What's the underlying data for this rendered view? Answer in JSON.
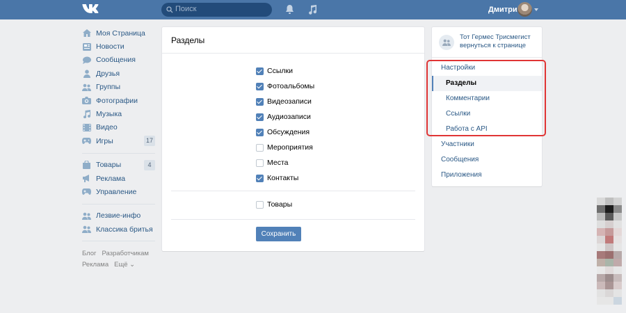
{
  "header": {
    "search_placeholder": "Поиск",
    "user_name": "Дмитрий",
    "colors": {
      "bar": "#4a76a8"
    }
  },
  "left_nav": {
    "main": [
      {
        "label": "Моя Страница",
        "icon": "home-icon"
      },
      {
        "label": "Новости",
        "icon": "news-icon"
      },
      {
        "label": "Сообщения",
        "icon": "message-icon"
      },
      {
        "label": "Друзья",
        "icon": "friend-icon"
      },
      {
        "label": "Группы",
        "icon": "groups-icon"
      },
      {
        "label": "Фотографии",
        "icon": "camera-icon"
      },
      {
        "label": "Музыка",
        "icon": "music-icon"
      },
      {
        "label": "Видео",
        "icon": "video-icon"
      },
      {
        "label": "Игры",
        "icon": "gamepad-icon",
        "badge": "17"
      }
    ],
    "secondary": [
      {
        "label": "Товары",
        "icon": "bag-icon",
        "badge": "4"
      },
      {
        "label": "Реклама",
        "icon": "megaphone-icon"
      },
      {
        "label": "Управление",
        "icon": "gamepad-icon"
      }
    ],
    "groups": [
      {
        "label": "Лезвие-инфо",
        "icon": "groups-icon"
      },
      {
        "label": "Классика бритья",
        "icon": "groups-icon"
      }
    ],
    "footer": {
      "blog": "Блог",
      "developers": "Разработчикам",
      "ads": "Реклама",
      "more": "Ещё ⌄"
    }
  },
  "sections_card": {
    "title": "Разделы",
    "items": [
      {
        "label": "Ссылки",
        "checked": true
      },
      {
        "label": "Фотоальбомы",
        "checked": true
      },
      {
        "label": "Видеозаписи",
        "checked": true
      },
      {
        "label": "Аудиозаписи",
        "checked": true
      },
      {
        "label": "Обсуждения",
        "checked": true
      },
      {
        "label": "Мероприятия",
        "checked": false
      },
      {
        "label": "Места",
        "checked": false
      },
      {
        "label": "Контакты",
        "checked": true
      }
    ],
    "goods": {
      "label": "Товары",
      "checked": false
    },
    "save_label": "Сохранить",
    "colors": {
      "accent": "#5181b8"
    }
  },
  "right_panel": {
    "group_name": "Тот Гермес Трисмегист",
    "back_link": "вернуться к странице",
    "settings_label": "Настройки",
    "settings_sub": [
      {
        "label": "Разделы",
        "active": true
      },
      {
        "label": "Комментарии",
        "active": false
      },
      {
        "label": "Ссылки",
        "active": false
      },
      {
        "label": "Работа с API",
        "active": false
      }
    ],
    "other": [
      {
        "label": "Участники"
      },
      {
        "label": "Сообщения"
      },
      {
        "label": "Приложения"
      }
    ],
    "highlight_color": "#e03535"
  }
}
